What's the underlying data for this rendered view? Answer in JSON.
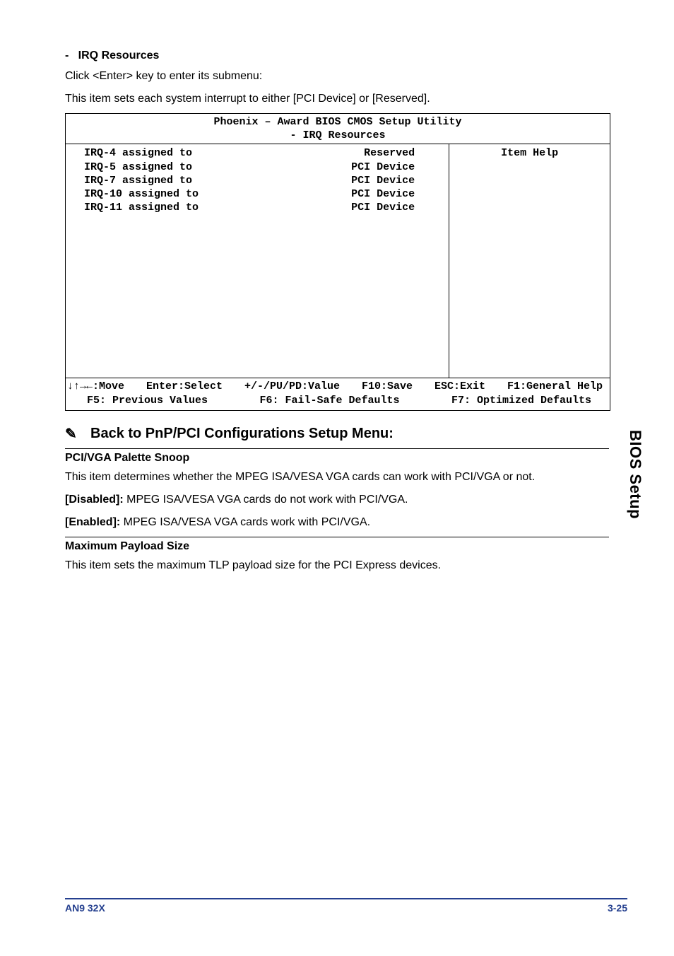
{
  "section": {
    "bullet": "-",
    "heading": "IRQ Resources",
    "para1": "Click <Enter> key to enter its submenu:",
    "para2": "This item sets each system interrupt to either [PCI Device] or [Reserved]."
  },
  "bios": {
    "title": "Phoenix – Award BIOS CMOS Setup Utility",
    "subtitle": "- IRQ Resources",
    "help_label": "Item Help",
    "rows": [
      {
        "left": "IRQ-4  assigned to",
        "right": "Reserved"
      },
      {
        "left": "IRQ-5  assigned to",
        "right": "PCI Device"
      },
      {
        "left": "IRQ-7  assigned to",
        "right": "PCI Device"
      },
      {
        "left": "IRQ-10 assigned to",
        "right": "PCI Device"
      },
      {
        "left": "IRQ-11 assigned to",
        "right": "PCI Device"
      }
    ],
    "footer1_a": "↓↑→←:Move",
    "footer1_b": "Enter:Select",
    "footer1_c": "+/-/PU/PD:Value",
    "footer1_d": "F10:Save",
    "footer1_e": "ESC:Exit",
    "footer1_f": "F1:General Help",
    "footer2_a": "F5: Previous Values",
    "footer2_b": "F6: Fail-Safe Defaults",
    "footer2_c": "F7: Optimized Defaults"
  },
  "hand": {
    "icon": "✎",
    "text": "Back to PnP/PCI Configurations Setup Menu:"
  },
  "pci_snoop": {
    "heading": "PCI/VGA Palette Snoop",
    "para": "This item determines whether the MPEG ISA/VESA VGA cards can work with PCI/VGA or not.",
    "disabled_label": "[Disabled]:",
    "disabled_text": " MPEG ISA/VESA VGA cards do not work with PCI/VGA.",
    "enabled_label": "[Enabled]:",
    "enabled_text": " MPEG ISA/VESA VGA cards work with PCI/VGA."
  },
  "payload": {
    "heading": "Maximum Payload Size",
    "para": "This item sets the maximum TLP payload size for the PCI Express devices."
  },
  "sidebar_text": "BIOS Setup",
  "footer": {
    "left": "AN9 32X",
    "right": "3-25"
  }
}
